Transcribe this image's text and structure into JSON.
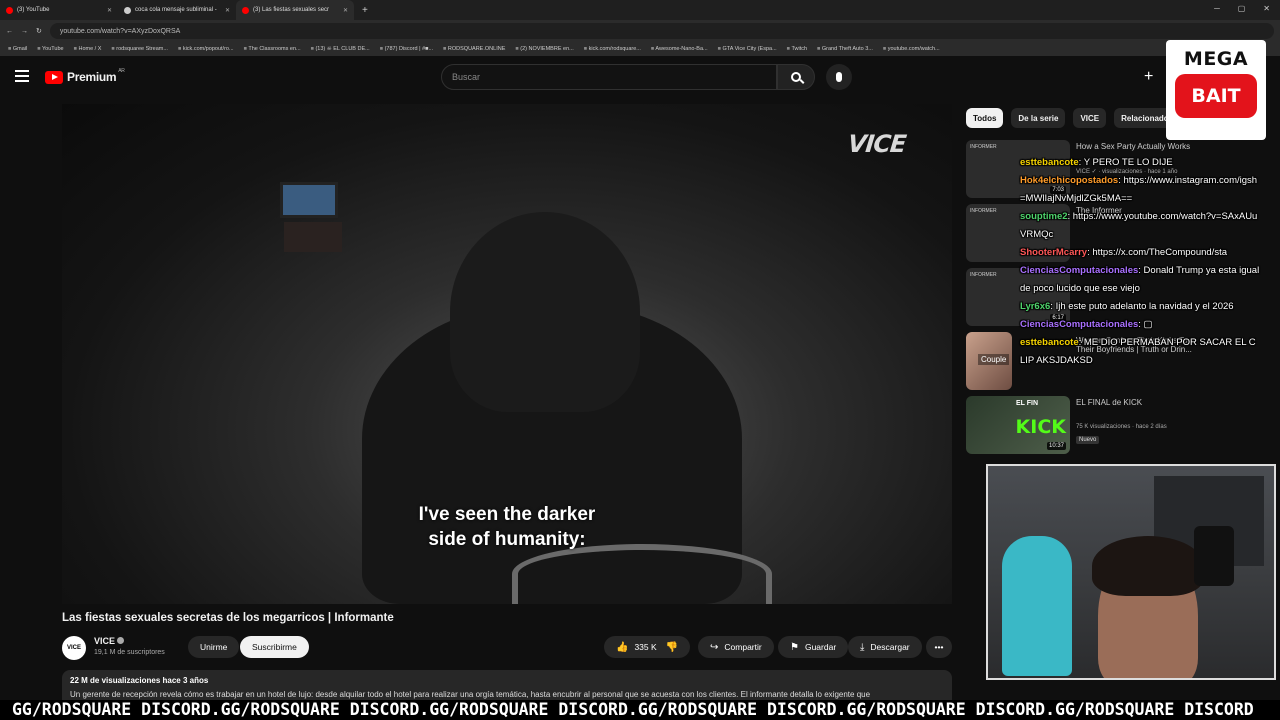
{
  "browser": {
    "tabs": [
      {
        "title": "(3) YouTube"
      },
      {
        "title": "coca cola mensaje subliminal -"
      },
      {
        "title": "(3) Las fiestas sexuales secr"
      }
    ],
    "url": "youtube.com/watch?v=AXyzDoxQRSA",
    "bookmarks": [
      "Gmail",
      "YouTube",
      "Home / X",
      "rodsquaree Stream...",
      "kick.com/popout/ro...",
      "The Classrooms en...",
      "(13) ☠ EL CLUB DE...",
      "(787) Discord | #■...",
      "RODSQUARE.ONLINE",
      "(2) NOVIEMBRE en...",
      "kick.com/rodsquare...",
      "Awesome-Nano-Ba...",
      "GTA Vice City (Espa...",
      "Twitch",
      "Grand Theft Auto 3...",
      "youtube.com/watch..."
    ]
  },
  "header": {
    "logo": "Premium",
    "region": "AR",
    "search_placeholder": "Buscar"
  },
  "video": {
    "watermark": "VICE",
    "subtitle": "I've seen the darker\nside of humanity:"
  },
  "info": {
    "title": "Las fiestas sexuales secretas de los megarricos | Informante",
    "channel": "VICE",
    "channel_avatar": "VICE",
    "subscribers": "19,1 M de suscriptores",
    "join": "Unirme",
    "subscribe": "Suscribirme",
    "likes": "335 K",
    "share": "Compartir",
    "save": "Guardar",
    "download": "Descargar",
    "desc_meta": "22 M de visualizaciones  hace 3 años",
    "desc_body": "Un gerente de recepción revela cómo es trabajar en un hotel de lujo: desde alquilar todo el hotel para realizar una orgía temática, hasta encubrir al personal que se acuesta con los clientes. El informante detalla lo exigente que"
  },
  "sidebar": {
    "chips": [
      "Todos",
      "De la serie",
      "VICE",
      "Relacionado"
    ],
    "recs": [
      {
        "title": "How a Sex Party Actually Works",
        "tag": "INFORMER",
        "duration": "7:03",
        "meta": "VICE ✓ · visualizaciones · hace 1 año"
      },
      {
        "title": "The Informer",
        "tag": "INFORMER",
        "duration": "",
        "meta": ""
      },
      {
        "title": "",
        "tag": "INFORMER",
        "duration": "6:17",
        "meta": ""
      },
      {
        "title": "Women Confess Their Kinks To Their Boyfriends | Truth or Drin...",
        "tag": "Couple",
        "duration": "",
        "meta": ""
      },
      {
        "title": "EL FINAL de KICK",
        "tag": "EL FIN",
        "duration": "10:37",
        "meta": "75 K visualizaciones · hace 2 días",
        "badge": "Nuevo"
      }
    ]
  },
  "chat": [
    {
      "user": "esttebancote",
      "color": "#f5d300",
      "text": "Y PERO TE LO DIJE"
    },
    {
      "user": "Hok4elchicopostados",
      "color": "#ff9c2a",
      "text": "https://www.instagram.com/igsh=MWlIajNvMjdlZGk5MA=="
    },
    {
      "user": "souptime2",
      "color": "#4ed36b",
      "text": "https://www.youtube.com/watch?v=SAxAUuVRMQc"
    },
    {
      "user": "ShooterMcarry",
      "color": "#ff5757",
      "text": "https://x.com/TheCompound/sta"
    },
    {
      "user": "CienciasComputacionales",
      "color": "#a970ff",
      "text": "Donald Trump ya esta igual de poco lucido que ese viejo"
    },
    {
      "user": "Lyr6x6",
      "color": "#4ed36b",
      "text": "Ijh este puto adelanto la navidad y el 2026"
    },
    {
      "user": "CienciasComputacionales",
      "color": "#a970ff",
      "text": "▢"
    },
    {
      "user": "esttebancote",
      "color": "#f5d300",
      "text": "ME DIO PERMABAN POR SACAR EL CLIP AKSJDAKSD"
    }
  ],
  "overlay": {
    "mega": "MEGA",
    "bait": "BAIT"
  },
  "ticker": "GG/RODSQUARE DISCORD.GG/RODSQUARE DISCORD.GG/RODSQUARE DISCORD.GG/RODSQUARE DISCORD.GG/RODSQUARE DISCORD.GG/RODSQUARE DISCORD"
}
